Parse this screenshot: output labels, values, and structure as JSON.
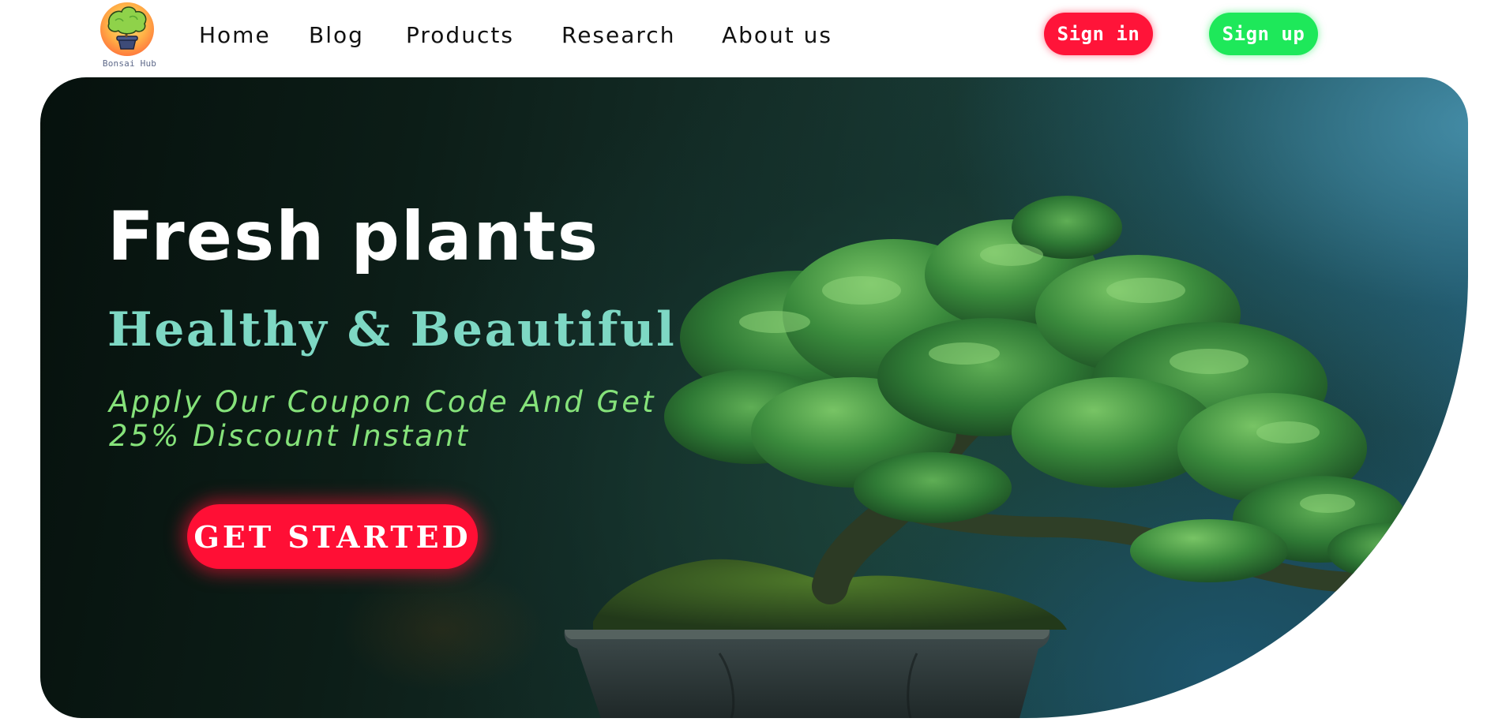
{
  "brand": {
    "name": "Bonsai Hub",
    "logo_icon": "tree-in-pot-icon"
  },
  "nav": {
    "links": [
      {
        "label": "Home"
      },
      {
        "label": "Blog"
      },
      {
        "label": "Products"
      },
      {
        "label": "Research"
      },
      {
        "label": "About us"
      }
    ],
    "sign_in_label": "Sign in",
    "sign_up_label": "Sign up"
  },
  "hero": {
    "title": "Fresh plants",
    "subtitle": "Healthy & Beautiful",
    "coupon_text": "Apply Our Coupon Code And Get 25% Discount Instant",
    "cta_label": "GET STARTED",
    "image": "bonsai-tree-illustration"
  },
  "colors": {
    "sign_in": "#ff1439",
    "sign_up": "#1ee85a",
    "subtitle": "#7ed8c4",
    "coupon": "#85e27a",
    "cta": "#ff0f35"
  }
}
